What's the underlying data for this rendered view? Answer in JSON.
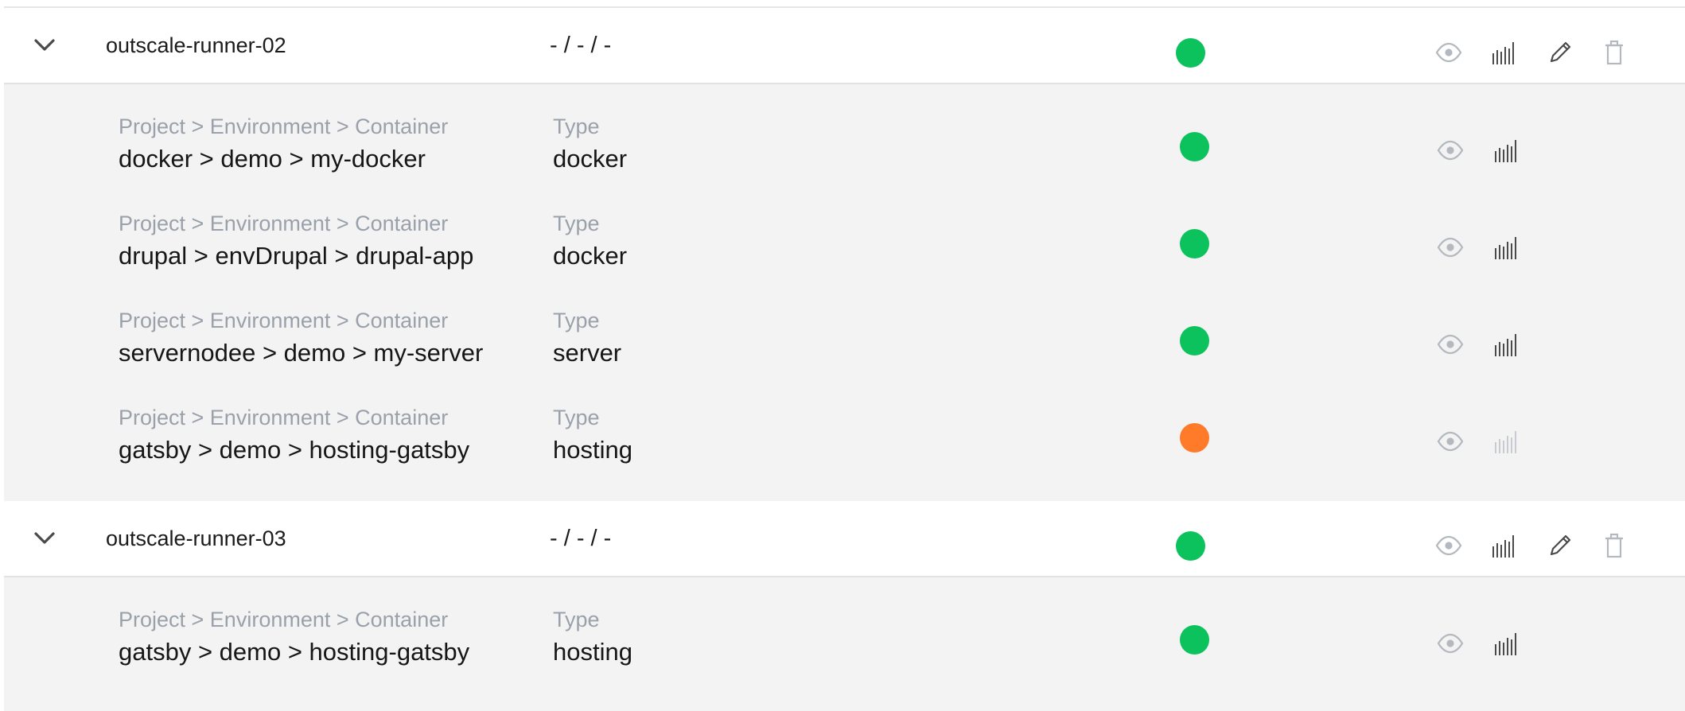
{
  "colors": {
    "ok": "#0cc25d",
    "warn": "#ff7a29",
    "icon_gray": "#b4b9bf",
    "icon_dark": "#4a4a4a",
    "icon_disabled": "#c8ccd0"
  },
  "runners": [
    {
      "name": "outscale-runner-02",
      "summary": "- / - / -",
      "status": "ok",
      "containers": [
        {
          "path_label": "Project > Environment > Container",
          "path": "docker > demo > my-docker",
          "type_label": "Type",
          "type": "docker",
          "status": "ok"
        },
        {
          "path_label": "Project > Environment > Container",
          "path": "drupal > envDrupal > drupal-app",
          "type_label": "Type",
          "type": "docker",
          "status": "ok"
        },
        {
          "path_label": "Project > Environment > Container",
          "path": "servernodee > demo > my-server",
          "type_label": "Type",
          "type": "server",
          "status": "ok"
        },
        {
          "path_label": "Project > Environment > Container",
          "path": "gatsby > demo > hosting-gatsby",
          "type_label": "Type",
          "type": "hosting",
          "status": "warn"
        }
      ]
    },
    {
      "name": "outscale-runner-03",
      "summary": "- / - / -",
      "status": "ok",
      "containers": [
        {
          "path_label": "Project > Environment > Container",
          "path": "gatsby > demo > hosting-gatsby",
          "type_label": "Type",
          "type": "hosting",
          "status": "ok"
        }
      ]
    }
  ],
  "icons": {
    "expand": "chevron-down-icon",
    "view": "eye-icon",
    "logs": "logs-bars-icon",
    "edit": "pencil-icon",
    "delete": "trash-icon"
  }
}
